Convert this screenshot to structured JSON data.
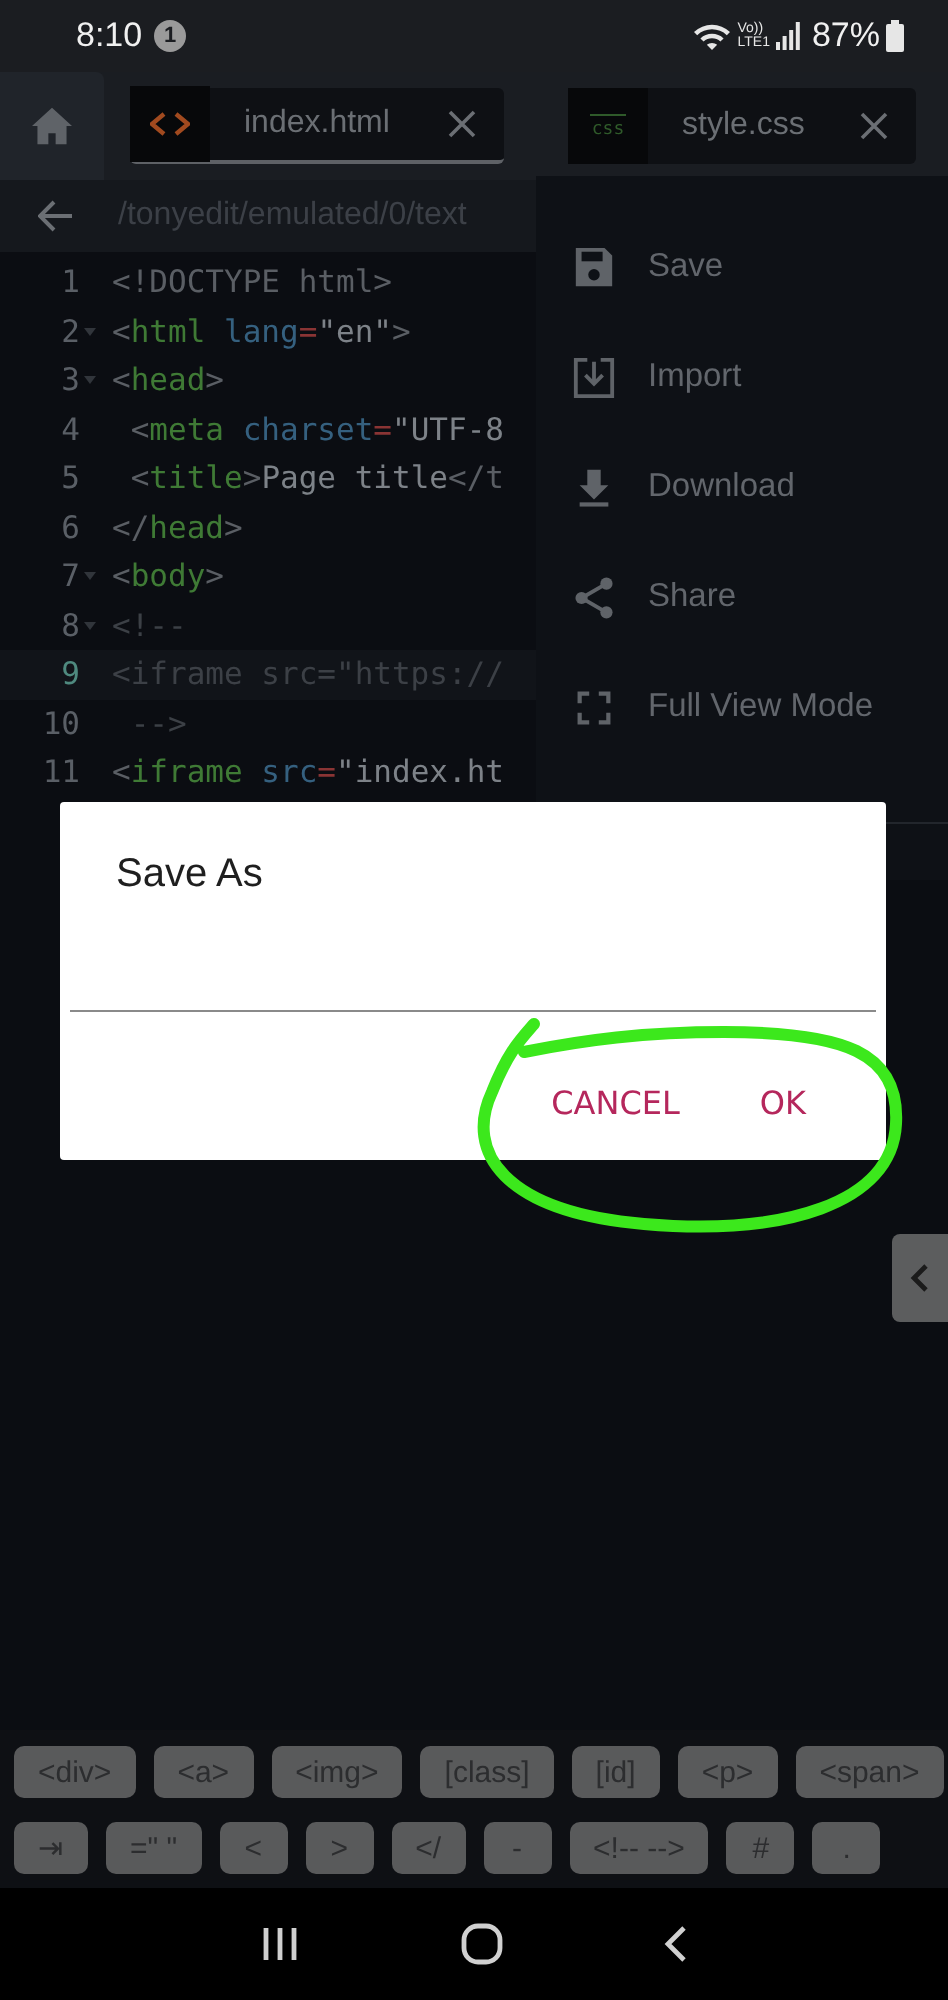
{
  "status_bar": {
    "time": "8:10",
    "notification_count": "1",
    "network_top": "Vo))",
    "network_bottom": "LTE1",
    "battery": "87%"
  },
  "tabs": [
    {
      "label": "index.html",
      "kind": "html",
      "selected": true
    },
    {
      "label": "style.css",
      "kind": "css",
      "badge": "css",
      "selected": false
    }
  ],
  "path": "/tonyedit/emulated/0/text",
  "code": {
    "lines": [
      {
        "number": "1",
        "foldable": false,
        "current": false,
        "tokens": [
          {
            "kind": "punct",
            "text": "<!DOCTYPE html>"
          }
        ]
      },
      {
        "number": "2",
        "foldable": true,
        "current": false,
        "tokens": [
          {
            "kind": "punct",
            "text": "<"
          },
          {
            "kind": "tag",
            "text": "html"
          },
          {
            "kind": "attr",
            "text": " lang"
          },
          {
            "kind": "op",
            "text": "="
          },
          {
            "kind": "string",
            "text": "\"en\""
          },
          {
            "kind": "punct",
            "text": ">"
          }
        ]
      },
      {
        "number": "3",
        "foldable": true,
        "current": false,
        "tokens": [
          {
            "kind": "punct",
            "text": "<"
          },
          {
            "kind": "tag",
            "text": "head"
          },
          {
            "kind": "punct",
            "text": ">"
          }
        ]
      },
      {
        "number": "4",
        "foldable": false,
        "current": false,
        "tokens": [
          {
            "kind": "punct",
            "text": " <"
          },
          {
            "kind": "tag",
            "text": "meta"
          },
          {
            "kind": "attr",
            "text": " charset"
          },
          {
            "kind": "op",
            "text": "="
          },
          {
            "kind": "string",
            "text": "\"UTF-8"
          }
        ]
      },
      {
        "number": "5",
        "foldable": false,
        "current": false,
        "tokens": [
          {
            "kind": "punct",
            "text": " <"
          },
          {
            "kind": "tag",
            "text": "title"
          },
          {
            "kind": "punct",
            "text": ">"
          },
          {
            "kind": "string",
            "text": "Page title"
          },
          {
            "kind": "punct",
            "text": "</t"
          }
        ]
      },
      {
        "number": "6",
        "foldable": false,
        "current": false,
        "tokens": [
          {
            "kind": "punct",
            "text": "</"
          },
          {
            "kind": "tag",
            "text": "head"
          },
          {
            "kind": "punct",
            "text": ">"
          }
        ]
      },
      {
        "number": "7",
        "foldable": true,
        "current": false,
        "tokens": [
          {
            "kind": "punct",
            "text": "<"
          },
          {
            "kind": "tag",
            "text": "body"
          },
          {
            "kind": "punct",
            "text": ">"
          }
        ]
      },
      {
        "number": "8",
        "foldable": true,
        "current": false,
        "tokens": [
          {
            "kind": "comment",
            "text": "<!--"
          }
        ]
      },
      {
        "number": "9",
        "foldable": false,
        "current": true,
        "tokens": [
          {
            "kind": "comment",
            "text": "<iframe src=\"https://"
          }
        ]
      },
      {
        "number": "10",
        "foldable": false,
        "current": false,
        "tokens": [
          {
            "kind": "comment",
            "text": " -->"
          }
        ]
      },
      {
        "number": "11",
        "foldable": false,
        "current": false,
        "tokens": [
          {
            "kind": "punct",
            "text": "<"
          },
          {
            "kind": "tag",
            "text": "iframe"
          },
          {
            "kind": "attr",
            "text": " src"
          },
          {
            "kind": "op",
            "text": "="
          },
          {
            "kind": "string",
            "text": "\"index.ht"
          }
        ]
      }
    ]
  },
  "menu": {
    "items": [
      {
        "label": "Save",
        "kind": "save"
      },
      {
        "label": "Import",
        "kind": "import"
      },
      {
        "label": "Download",
        "kind": "download"
      },
      {
        "label": "Share",
        "kind": "share"
      },
      {
        "label": "Full View Mode",
        "kind": "fullscreen"
      }
    ]
  },
  "dialog": {
    "title": "Save As",
    "buttons": [
      "CANCEL",
      "OK"
    ]
  },
  "shortcut_keys": [
    [
      "<div>",
      "<a>",
      "<img>",
      "[class]",
      "[id]",
      "<p>",
      "<span>"
    ],
    [
      "⇥",
      "=\" \"",
      "<",
      ">",
      "</",
      "-",
      "<!-- -->",
      "#",
      "."
    ]
  ]
}
